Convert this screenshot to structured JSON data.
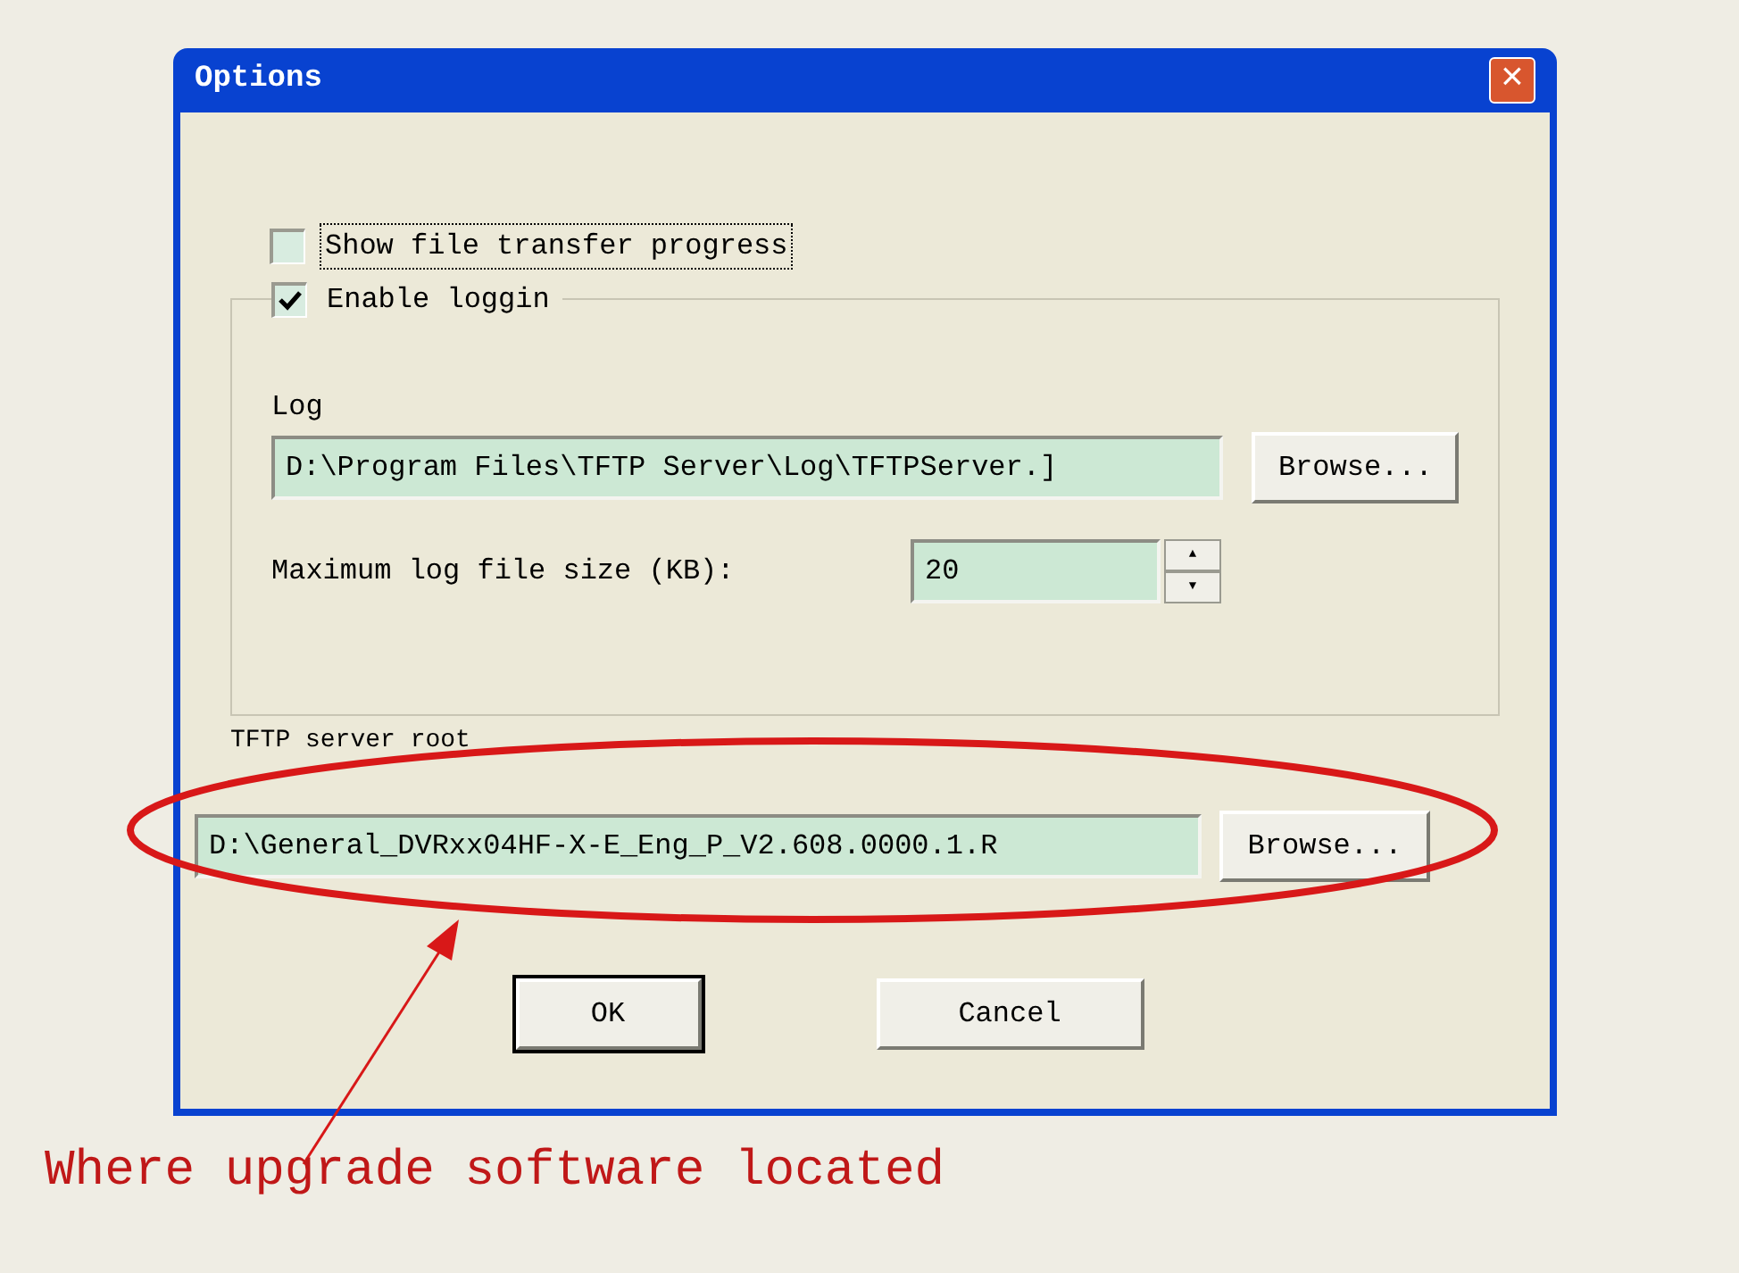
{
  "window": {
    "title": "Options",
    "close": "×"
  },
  "show_progress": {
    "label": "Show file transfer progress",
    "checked": false,
    "focused": true
  },
  "logging": {
    "label": "Enable loggin",
    "checked": true,
    "log": {
      "label": "Log",
      "value": "D:\\Program Files\\TFTP Server\\Log\\TFTPServer.]",
      "button": "Browse..."
    },
    "max_size": {
      "label": "Maximum log file size (KB):",
      "value": "20",
      "up": "▲",
      "down": "▼"
    }
  },
  "root": {
    "label": "TFTP server root",
    "value": "D:\\General_DVRxx04HF-X-E_Eng_P_V2.608.0000.1.R",
    "button": "Browse..."
  },
  "buttons": [
    {
      "label": "OK",
      "default": true
    },
    {
      "label": "Cancel",
      "default": false
    }
  ],
  "annotation": "Where upgrade software located"
}
